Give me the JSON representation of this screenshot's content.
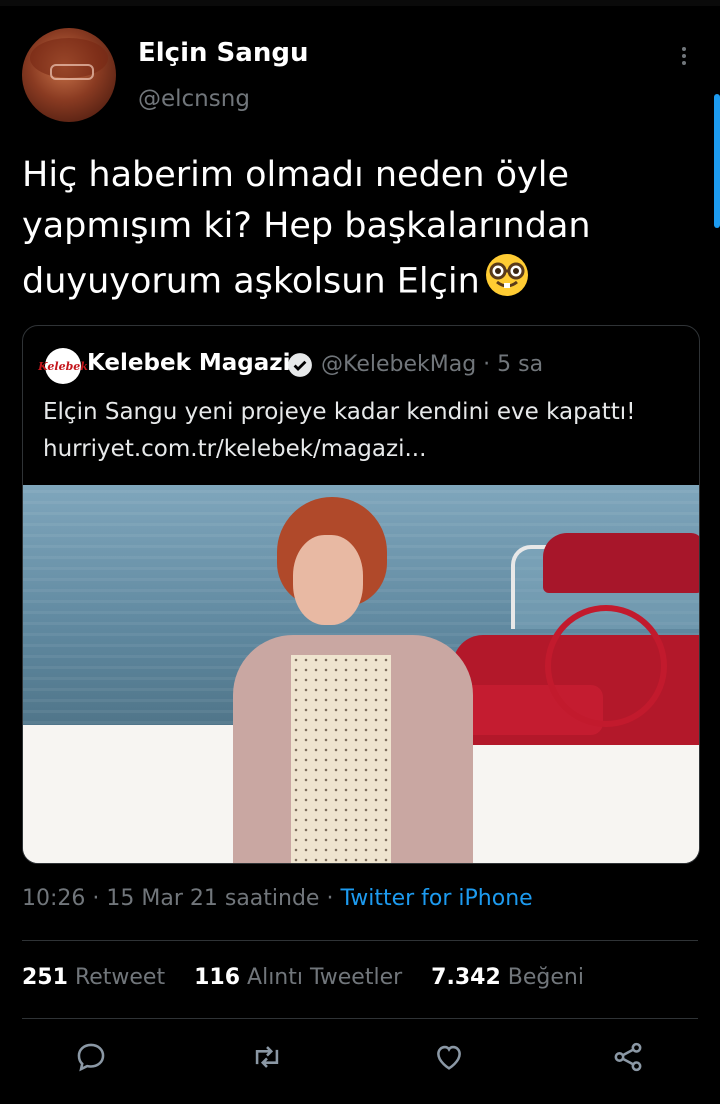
{
  "tweet": {
    "author_name": "Elçin Sangu",
    "author_handle": "@elcnsng",
    "text_line1": "Hiç haberim olmadı neden öyle",
    "text_line2": "yapmışım ki? Hep başkalarından",
    "text_line3": "duyuyorum aşkolsun Elçin",
    "emoji": "nerd-face"
  },
  "quoted": {
    "logo_text": "Kelebek",
    "name": "Kelebek Magazin",
    "handle_time": "@KelebekMag · 5 sa",
    "text_line1": "Elçin Sangu yeni projeye kadar kendini eve kapattı!",
    "text_line2": "hurriyet.com.tr/kelebek/magazi..."
  },
  "meta": {
    "time_date": "10:26 · 15 Mar 21 saatinde · ",
    "source": "Twitter for iPhone"
  },
  "stats": {
    "retweets_count": "251",
    "retweets_label": "Retweet",
    "quotes_count": "116",
    "quotes_label": "Alıntı Tweetler",
    "likes_count": "7.342",
    "likes_label": "Beğeni"
  },
  "colors": {
    "background": "#000000",
    "text": "#e7e9ea",
    "secondary": "#71767b",
    "accent": "#1d9bf0"
  }
}
